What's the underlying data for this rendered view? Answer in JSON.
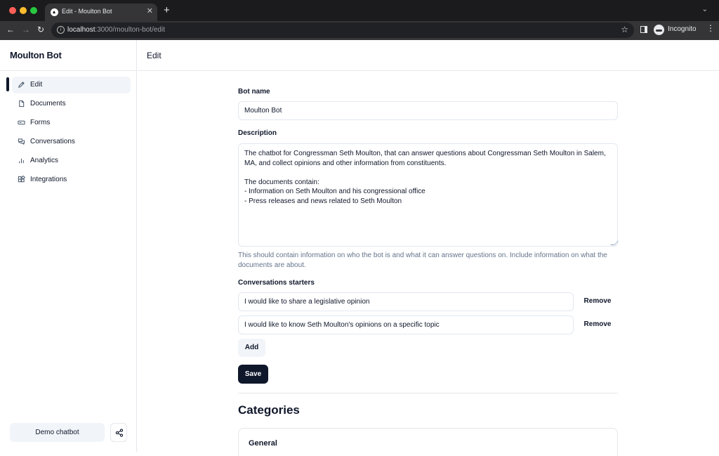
{
  "browser": {
    "tab_title": "Edit - Moulton Bot",
    "url_host": "localhost",
    "url_path": ":3000/moulton-bot/edit",
    "profile_label": "Incognito"
  },
  "sidebar": {
    "brand": "Moulton Bot",
    "items": [
      {
        "label": "Edit",
        "icon": "pencil-icon",
        "active": true
      },
      {
        "label": "Documents",
        "icon": "document-icon"
      },
      {
        "label": "Forms",
        "icon": "form-icon"
      },
      {
        "label": "Conversations",
        "icon": "conversations-icon"
      },
      {
        "label": "Analytics",
        "icon": "analytics-icon"
      },
      {
        "label": "Integrations",
        "icon": "integrations-icon"
      }
    ],
    "demo_button": "Demo chatbot"
  },
  "header": {
    "title": "Edit"
  },
  "form": {
    "bot_name_label": "Bot name",
    "bot_name_value": "Moulton Bot",
    "description_label": "Description",
    "description_value": "The chatbot for Congressman Seth Moulton, that can answer questions about Congressman Seth Moulton in Salem, MA, and collect opinions and other information from constituents.\n\nThe documents contain:\n- Information on Seth Moulton and his congressional office\n- Press releases and news related to Seth Moulton",
    "description_help": "This should contain information on who the bot is and what it can answer questions on. Include information on what the documents are about.",
    "starters_label": "Conversations starters",
    "starters": [
      {
        "value": "I would like to share a legislative opinion",
        "remove_label": "Remove"
      },
      {
        "value": "I would like to know Seth Moulton's opinions on a specific topic",
        "remove_label": "Remove"
      }
    ],
    "add_label": "Add",
    "save_label": "Save"
  },
  "categories": {
    "title": "Categories",
    "cards": [
      {
        "title": "General"
      }
    ]
  }
}
